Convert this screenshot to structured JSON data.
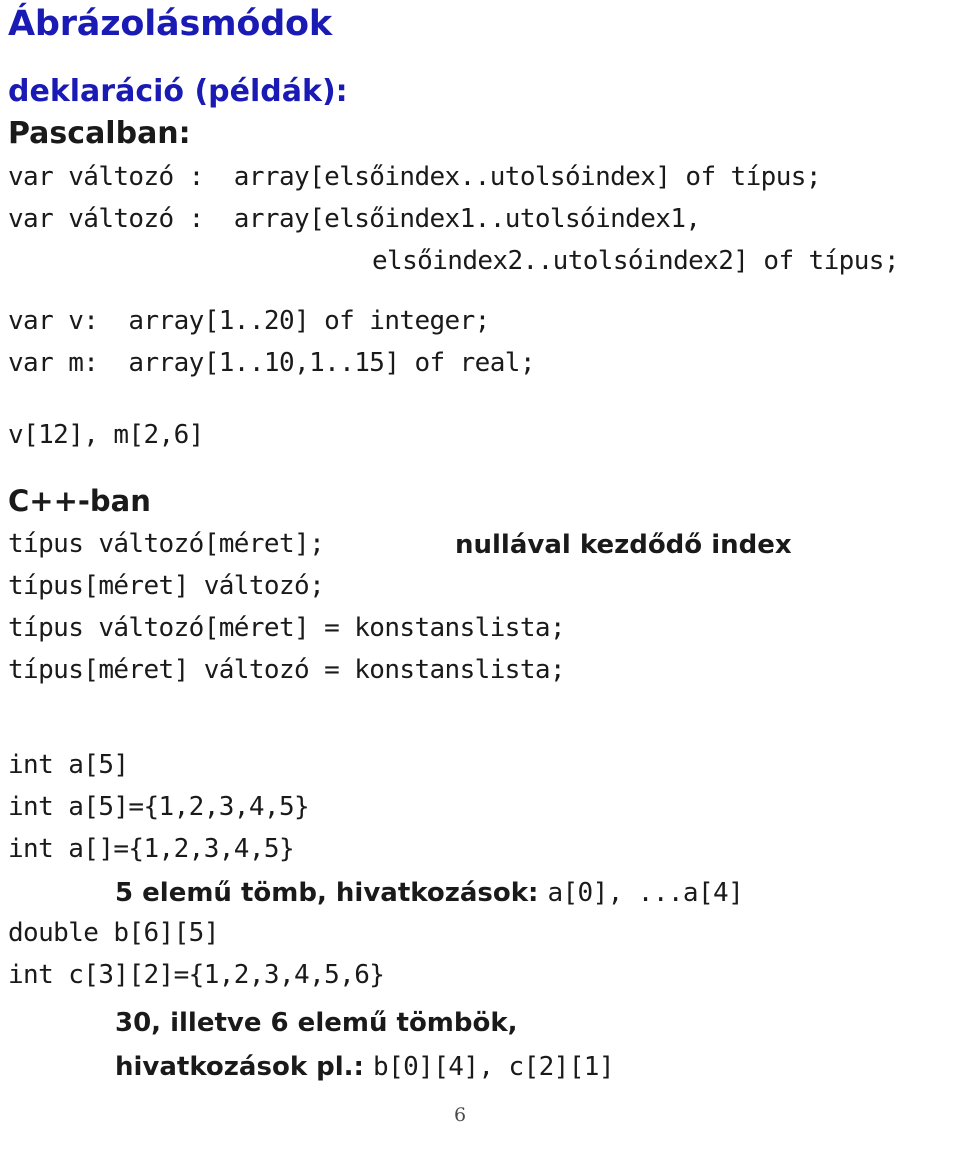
{
  "slide": {
    "title": "Ábrázolásmódok",
    "subheading_declaration": "deklaráció (példák):",
    "subheading_pascal": "Pascalban:",
    "section_cpp": "C++-ban"
  },
  "pascal": {
    "lines": [
      "var változó :  array[elsőindex..utolsóindex] of típus;",
      "var változó :  array[elsőindex1..utolsóindex1,",
      "elsőindex2..utolsóindex2] of típus;",
      "var v:  array[1..20] of integer;",
      "var m:  array[1..10,1..15] of real;",
      "v[12], m[2,6]"
    ]
  },
  "cpp": {
    "syntax_lines": [
      "típus változó[méret];",
      "típus[méret] változó;",
      "típus változó[méret] = konstanslista;",
      "típus[méret] változó = konstanslista;"
    ],
    "note_zero_index": "nullával kezdődő index",
    "example_lines": [
      "int a[5]",
      "int a[5]={1,2,3,4,5}",
      "int a[]={1,2,3,4,5}",
      "double b[6][5]",
      "int c[3][2]={1,2,3,4,5,6}"
    ],
    "note_five_element_prefix": "5 elemű tömb, hivatkozások: ",
    "note_five_element_mono": "a[0], ...a[4]",
    "note_thirty_line1": "30, illetve 6 elemű tömbök,",
    "note_thirty_prefix": "hivatkozások pl.: ",
    "note_thirty_mono": "b[0][4], c[2][1]"
  },
  "footer": {
    "page_number": "6"
  },
  "colors": {
    "heading_blue": "#1a1ab4",
    "text_black": "#1a1a1a",
    "background": "#ffffff"
  }
}
